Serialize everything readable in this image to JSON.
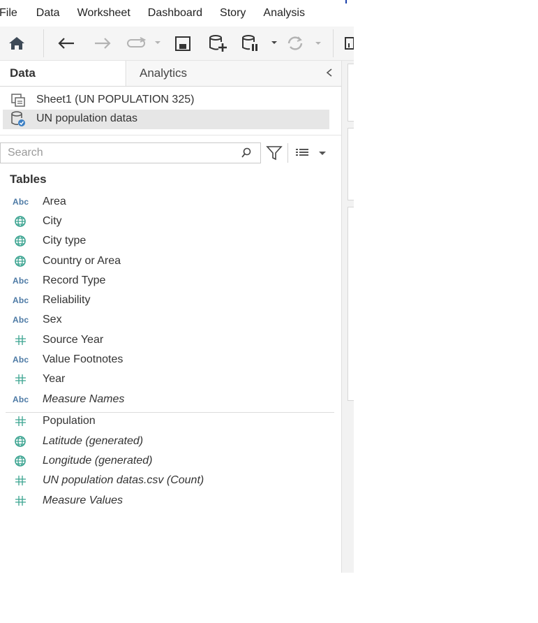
{
  "menu": [
    "File",
    "Data",
    "Worksheet",
    "Dashboard",
    "Story",
    "Analysis"
  ],
  "toolbar": {
    "icons": [
      "home-icon",
      "undo-icon",
      "redo-icon",
      "replay-icon",
      "save-icon",
      "new-datasource-icon",
      "pause-updates-icon",
      "refresh-icon",
      "show-me-icon"
    ]
  },
  "tabs": {
    "data": "Data",
    "analytics": "Analytics"
  },
  "datasources": [
    {
      "label": "Sheet1 (UN POPULATION 325)",
      "icon": "linked-sheet-icon"
    },
    {
      "label": "UN population datas",
      "icon": "datasource-check-icon",
      "selected": true
    }
  ],
  "search": {
    "placeholder": "Search"
  },
  "tables_heading": "Tables",
  "fields": [
    {
      "label": "Area",
      "type": "Abc"
    },
    {
      "label": "City",
      "type": "geo"
    },
    {
      "label": "City type",
      "type": "geo"
    },
    {
      "label": "Country or Area",
      "type": "geo"
    },
    {
      "label": "Record Type",
      "type": "Abc"
    },
    {
      "label": "Reliability",
      "type": "Abc"
    },
    {
      "label": "Sex",
      "type": "Abc"
    },
    {
      "label": "Source Year",
      "type": "#"
    },
    {
      "label": "Value Footnotes",
      "type": "Abc"
    },
    {
      "label": "Year",
      "type": "#"
    },
    {
      "label": "Measure Names",
      "type": "Abc",
      "italic": true
    }
  ],
  "measures": [
    {
      "label": "Population",
      "type": "#"
    },
    {
      "label": "Latitude (generated)",
      "type": "geo",
      "italic": true
    },
    {
      "label": "Longitude (generated)",
      "type": "geo",
      "italic": true
    },
    {
      "label": "UN population datas.csv (Count)",
      "type": "#",
      "italic": true
    },
    {
      "label": "Measure Values",
      "type": "#",
      "italic": true
    }
  ],
  "colors": {
    "dimension": "#4d7aa5",
    "measure": "#3aa390",
    "selected_bg": "#e6e6e6"
  }
}
